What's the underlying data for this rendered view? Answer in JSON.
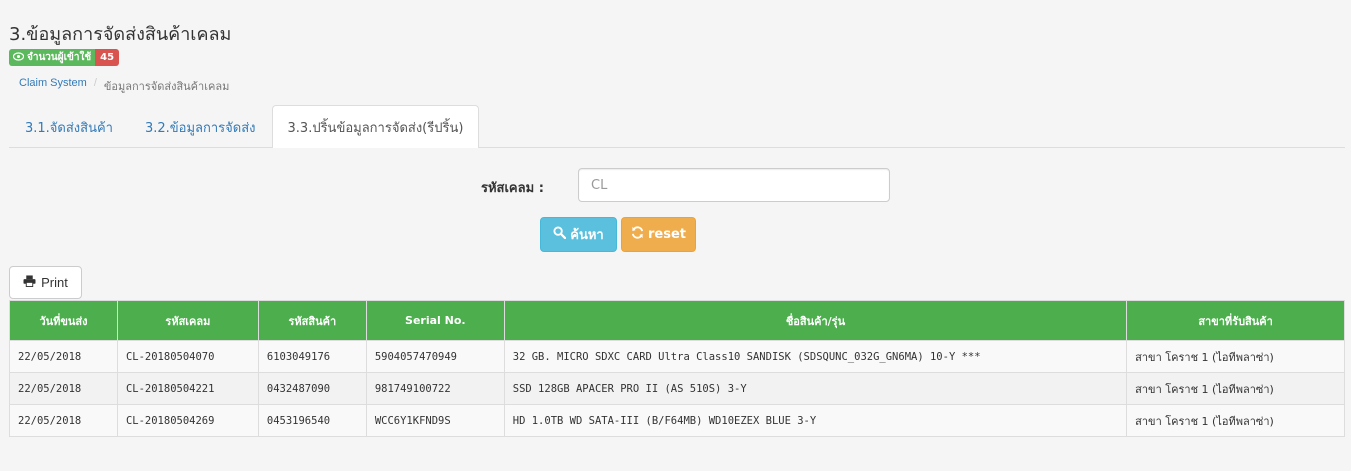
{
  "page": {
    "title": "3.ข้อมูลการจัดส่งสินค้าเคลม",
    "viewer_label": "จำนวนผู้เข้าใช้",
    "viewer_count": "45"
  },
  "breadcrumb": {
    "home": "Claim System",
    "separator": "/",
    "current": "ข้อมูลการจัดส่งสินค้าเคลม"
  },
  "tabs": [
    {
      "label": "3.1.จัดส่งสินค้า",
      "active": false
    },
    {
      "label": "3.2.ข้อมูลการจัดส่ง",
      "active": false
    },
    {
      "label": "3.3.ปริ้นข้อมูลการจัดส่ง(รีปริ้น)",
      "active": true
    }
  ],
  "search": {
    "label": "รหัสเคลม :",
    "placeholder": "CL",
    "value": "",
    "search_button": "ค้นหา",
    "reset_button": "reset"
  },
  "print_button": "Print",
  "table": {
    "columns": [
      "วันที่ขนส่ง",
      "รหัสเคลม",
      "รหัสสินค้า",
      "Serial No.",
      "ชื่อสินค้า/รุ่น",
      "สาขาที่รับสินค้า"
    ],
    "rows": [
      [
        "22/05/2018",
        "CL-20180504070",
        "6103049176",
        "5904057470949",
        "32 GB. MICRO SDXC CARD Ultra Class10 SANDISK (SDSQUNC_032G_GN6MA) 10-Y ***",
        "สาขา โคราช 1 (ไอทีพลาซ่า)"
      ],
      [
        "22/05/2018",
        "CL-20180504221",
        "0432487090",
        "981749100722",
        "SSD 128GB APACER PRO II (AS 510S) 3-Y",
        "สาขา โคราช 1 (ไอทีพลาซ่า)"
      ],
      [
        "22/05/2018",
        "CL-20180504269",
        "0453196540",
        "WCC6Y1KFND9S",
        "HD 1.0TB WD SATA-III (B/F64MB) WD10EZEX BLUE 3-Y",
        "สาขา โคราช 1 (ไอทีพลาซ่า)"
      ]
    ]
  },
  "colors": {
    "header_green": "#4cae4c",
    "link_blue": "#337ab7",
    "info_button": "#5bc0de",
    "warning_button": "#f0ad4e",
    "badge_red": "#d9534f"
  },
  "icons": {
    "viewer": "eye-icon",
    "search": "search-icon",
    "reset": "refresh-icon",
    "print": "printer-icon"
  }
}
